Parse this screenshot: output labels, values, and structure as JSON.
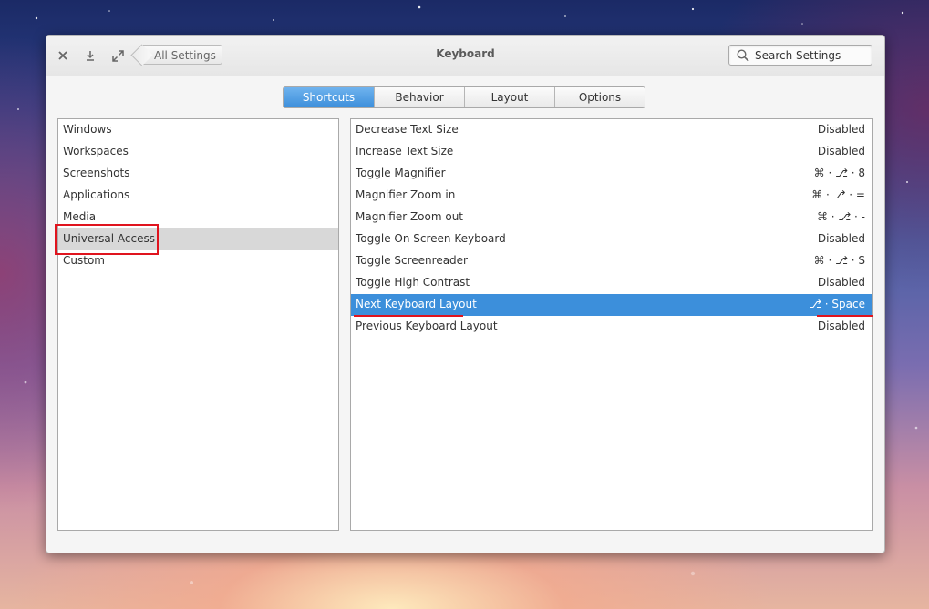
{
  "window": {
    "title": "Keyboard",
    "back_label": "All Settings",
    "search_placeholder": "Search Settings"
  },
  "tabs": [
    {
      "label": "Shortcuts",
      "active": true
    },
    {
      "label": "Behavior",
      "active": false
    },
    {
      "label": "Layout",
      "active": false
    },
    {
      "label": "Options",
      "active": false
    }
  ],
  "categories": [
    {
      "label": "Windows"
    },
    {
      "label": "Workspaces"
    },
    {
      "label": "Screenshots"
    },
    {
      "label": "Applications"
    },
    {
      "label": "Media"
    },
    {
      "label": "Universal Access",
      "selected": true
    },
    {
      "label": "Custom"
    }
  ],
  "shortcuts": [
    {
      "label": "Decrease Text Size",
      "accel": "Disabled"
    },
    {
      "label": "Increase Text Size",
      "accel": "Disabled"
    },
    {
      "label": "Toggle Magnifier",
      "accel": "⌘ · ⎇ · 8"
    },
    {
      "label": "Magnifier Zoom in",
      "accel": "⌘ · ⎇ · ="
    },
    {
      "label": "Magnifier Zoom out",
      "accel": "⌘ · ⎇ · -"
    },
    {
      "label": "Toggle On Screen Keyboard",
      "accel": "Disabled"
    },
    {
      "label": "Toggle Screenreader",
      "accel": "⌘ · ⎇ · S"
    },
    {
      "label": "Toggle High Contrast",
      "accel": "Disabled"
    },
    {
      "label": "Next Keyboard Layout",
      "accel": "⎇ · Space",
      "selected": true
    },
    {
      "label": "Previous Keyboard Layout",
      "accel": "Disabled"
    }
  ],
  "colors": {
    "accent": "#3c8fdb",
    "annotation": "#e0141e"
  },
  "icons": {
    "close": "close-icon",
    "download": "download-icon",
    "maximize": "maximize-icon",
    "search": "search-icon"
  }
}
